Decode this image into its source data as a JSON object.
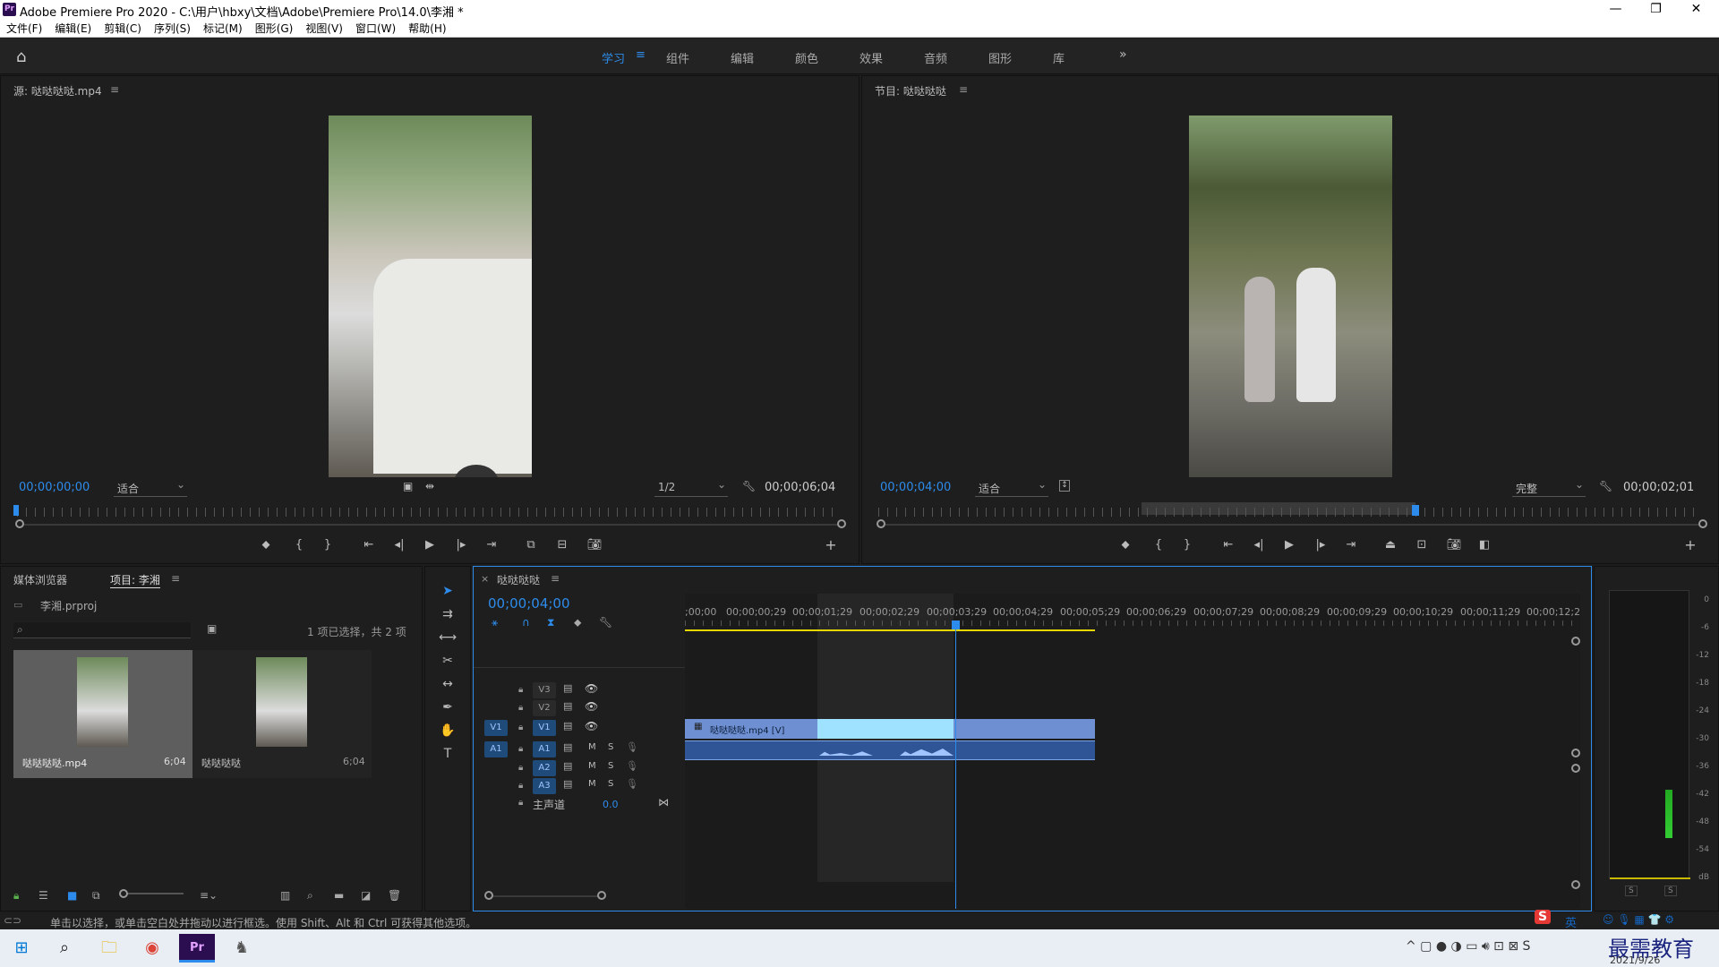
{
  "window": {
    "title": "Adobe Premiere Pro 2020 - C:\\用户\\hbxy\\文档\\Adobe\\Premiere Pro\\14.0\\李湘 *",
    "logo_text": "Pr"
  },
  "menu": [
    "文件(F)",
    "编辑(E)",
    "剪辑(C)",
    "序列(S)",
    "标记(M)",
    "图形(G)",
    "视图(V)",
    "窗口(W)",
    "帮助(H)"
  ],
  "workspaces": {
    "items": [
      "学习",
      "组件",
      "编辑",
      "颜色",
      "效果",
      "音频",
      "图形",
      "库"
    ],
    "active": "学习"
  },
  "source_monitor": {
    "title": "源: 哒哒哒哒.mp4",
    "timecode": "00;00;00;00",
    "fit": "适合",
    "resolution": "1/2",
    "duration": "00;00;06;04"
  },
  "program_monitor": {
    "title": "节目: 哒哒哒哒",
    "timecode": "00;00;04;00",
    "fit": "适合",
    "quality": "完整",
    "duration": "00;00;02;01"
  },
  "project_panel": {
    "tabs": [
      "媒体浏览器",
      "项目: 李湘"
    ],
    "project_file": "李湘.prproj",
    "selection_info": "1 项已选择，共 2 项",
    "items": [
      {
        "name": "哒哒哒哒.mp4",
        "duration": "6;04"
      },
      {
        "name": "哒哒哒哒",
        "duration": "6;04"
      }
    ]
  },
  "timeline": {
    "title": "哒哒哒哒",
    "timecode": "00;00;04;00",
    "ticks": [
      ";00;00",
      "00;00;00;29",
      "00;00;01;29",
      "00;00;02;29",
      "00;00;03;29",
      "00;00;04;29",
      "00;00;05;29",
      "00;00;06;29",
      "00;00;07;29",
      "00;00;08;29",
      "00;00;09;29",
      "00;00;10;29",
      "00;00;11;29",
      "00;00;12;2"
    ],
    "video_tracks": [
      "V3",
      "V2",
      "V1"
    ],
    "audio_tracks": [
      "A1",
      "A2",
      "A3"
    ],
    "clip_label": "哒哒哒哒.mp4 [V]",
    "master_label": "主声道",
    "master_value": "0.0",
    "mute": "M",
    "solo": "S"
  },
  "audio_meter": {
    "scale": [
      "0",
      "-6",
      "-12",
      "-18",
      "-24",
      "-30",
      "-36",
      "-42",
      "-48",
      "-54",
      "dB"
    ],
    "solo_labels": [
      "S",
      "S"
    ]
  },
  "status_text": "单击以选择，或单击空白处并拖动以进行框选。使用 Shift、Alt 和 Ctrl 可获得其他选项。",
  "taskbar": {
    "date": "2021/9/26",
    "watermark": "最需教育",
    "ime": "英"
  }
}
